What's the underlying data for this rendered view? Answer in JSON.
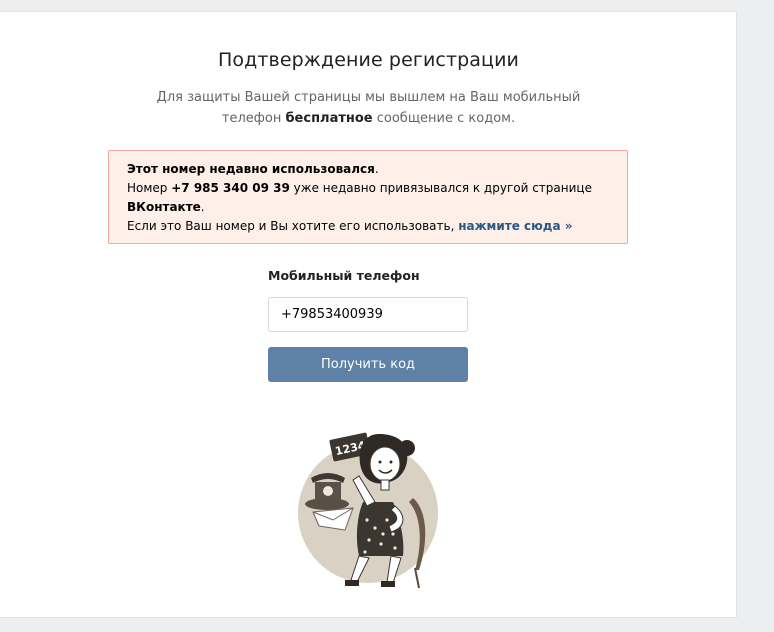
{
  "page": {
    "title": "Подтверждение регистрации",
    "subtitle_line1": "Для защиты Вашей страницы мы вышлем на Ваш мобильный",
    "subtitle_line2_prefix": "телефон ",
    "subtitle_line2_bold": "бесплатное",
    "subtitle_line2_suffix": " сообщение с кодом."
  },
  "warning": {
    "heading": "Этот номер недавно использовался",
    "heading_dot": ".",
    "line2_prefix": "Номер ",
    "phone_bold": "+7 985 340 09 39",
    "line2_suffix": " уже недавно привязывался к другой странице",
    "line3_bold": "ВКонтакте",
    "line3_dot": ".",
    "line4_text": "Если это Ваш номер и Вы хотите его использовать, ",
    "link_text": "нажмите сюда »"
  },
  "form": {
    "phone_label": "Мобильный телефон",
    "phone_value": "+79853400939",
    "submit_label": "Получить код"
  },
  "illustration": {
    "sign_text": "1234"
  },
  "colors": {
    "background": "#edeef0",
    "card": "#ffffff",
    "warning_bg": "#ffefe9",
    "warning_border": "#f2ab99",
    "link": "#2a5885",
    "button": "#5e81a8"
  }
}
